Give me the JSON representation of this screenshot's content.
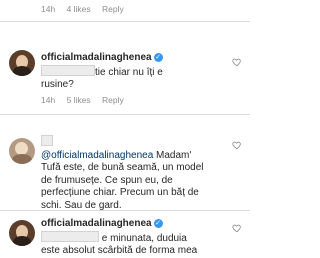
{
  "top_meta": {
    "time": "14h",
    "likes": "4 likes",
    "reply": "Reply"
  },
  "comment1": {
    "username": "officialmadalinaghenea",
    "text_line1": "tie chiar nu îți e",
    "text_line2": "rusine?",
    "time": "14h",
    "likes": "5 likes",
    "reply": "Reply"
  },
  "comment2": {
    "mention": "@officialmadalinaghenea",
    "text_line1_rest": " Madam'",
    "text_line2": "Tufă este, de bună seamă, un model",
    "text_line3": "de frumusețe. Ce spun eu, de",
    "text_line4": "perfecțiune chiar. Precum un băț de",
    "text_line5": "schi. Sau de gard."
  },
  "comment3": {
    "username": "officialmadalinaghenea",
    "text_line2_rest": "e minunata, duduia",
    "text_line3": "este absolut scârbită de forma mea"
  },
  "icons": {
    "heart": "heart-outline-icon",
    "verified": "verified-badge-icon"
  },
  "colors": {
    "verified": "#3897f0",
    "mention": "#003569",
    "meta": "#8e8e8e"
  }
}
